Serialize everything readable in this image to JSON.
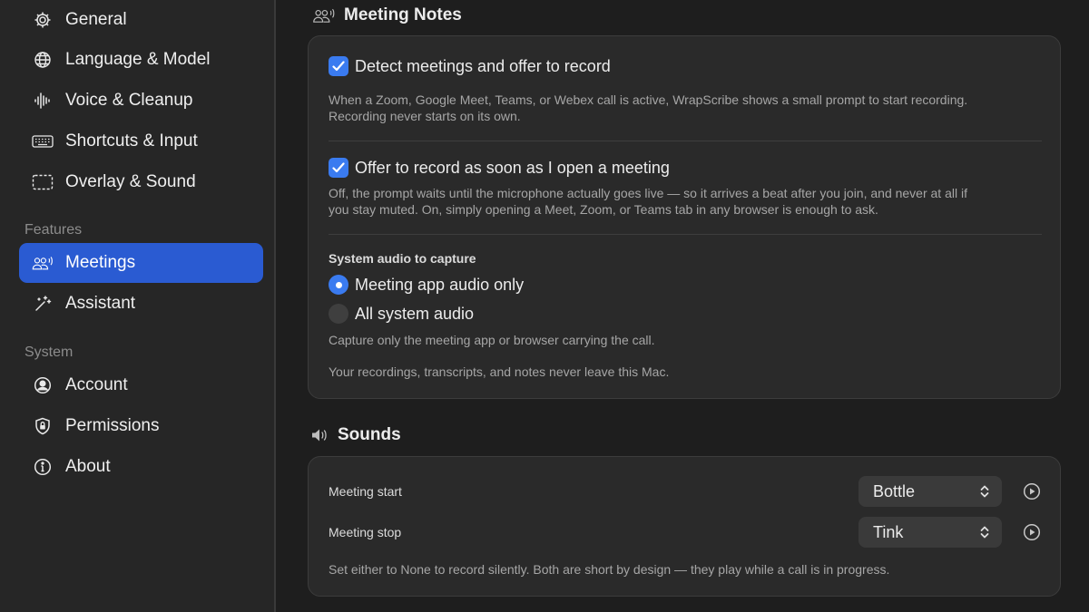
{
  "sidebar": {
    "items_top": [
      {
        "label": "General",
        "icon": "gear-icon"
      },
      {
        "label": "Language & Model",
        "icon": "globe-icon"
      },
      {
        "label": "Voice & Cleanup",
        "icon": "waveform-icon"
      },
      {
        "label": "Shortcuts & Input",
        "icon": "keyboard-icon"
      },
      {
        "label": "Overlay & Sound",
        "icon": "dashed-rect-icon"
      }
    ],
    "features_heading": "Features",
    "features": [
      {
        "label": "Meetings",
        "icon": "people-icon",
        "active": true
      },
      {
        "label": "Assistant",
        "icon": "magic-wand-icon"
      }
    ],
    "system_heading": "System",
    "system": [
      {
        "label": "Account",
        "icon": "person-circle-icon"
      },
      {
        "label": "Permissions",
        "icon": "shield-lock-icon"
      },
      {
        "label": "About",
        "icon": "info-circle-icon"
      }
    ]
  },
  "meeting_notes": {
    "title": "Meeting Notes",
    "detect": {
      "label": "Detect meetings and offer to record",
      "checked": true,
      "desc1": "When a Zoom, Google Meet, Teams, or Webex call is active, WrapScribe shows a small prompt to start recording.",
      "desc2": "Recording never starts on its own."
    },
    "offer": {
      "label": "Offer to record as soon as I open a meeting",
      "checked": true,
      "desc1": "Off, the prompt waits until the microphone actually goes live — so it arrives a beat after you join, and never at all if",
      "desc2": "you stay muted. On, simply opening a Meet, Zoom, or Teams tab in any browser is enough to ask."
    },
    "audio": {
      "heading": "System audio to capture",
      "options": [
        "Meeting app audio only",
        "All system audio"
      ],
      "selected": "Meeting app audio only",
      "desc": "Capture only the meeting app or browser carrying the call."
    },
    "privacy_note": "Your recordings, transcripts, and notes never leave this Mac."
  },
  "sounds": {
    "title": "Sounds",
    "start": {
      "label": "Meeting start",
      "value": "Bottle"
    },
    "stop": {
      "label": "Meeting stop",
      "value": "Tink"
    },
    "note": "Set either to None to record silently. Both are short by design — they play while a call is in progress."
  },
  "colors": {
    "accent": "#3a7bf0",
    "sidebar_active": "#2a5bd2",
    "background": "#1e1e1e",
    "card": "#2a2a2a"
  }
}
